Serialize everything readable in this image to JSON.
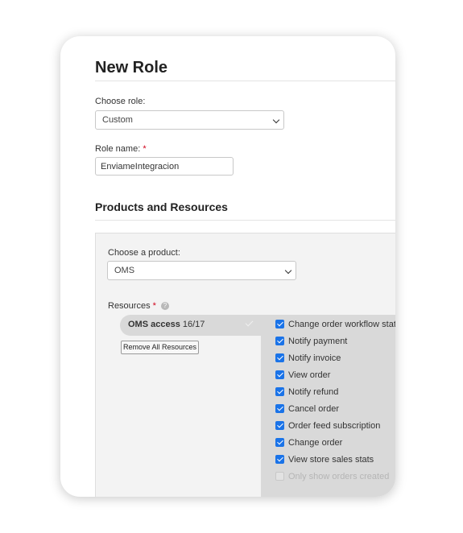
{
  "page": {
    "title": "New Role"
  },
  "role": {
    "choose_label": "Choose role:",
    "selected": "Custom",
    "name_label": "Role name:",
    "required_mark": "*",
    "name_value": "EnviameIntegracion"
  },
  "products": {
    "section_title": "Products and Resources",
    "choose_label": "Choose a product:",
    "selected": "OMS",
    "resources_label": "Resources",
    "help_glyph": "?",
    "product_name": "OMS access",
    "product_count": "16/17",
    "remove_all_label": "Remove All Resources",
    "resources": [
      {
        "label": "Change order workflow status",
        "checked": true
      },
      {
        "label": "Notify payment",
        "checked": true
      },
      {
        "label": "Notify invoice",
        "checked": true
      },
      {
        "label": "View order",
        "checked": true
      },
      {
        "label": "Notify refund",
        "checked": true
      },
      {
        "label": "Cancel order",
        "checked": true
      },
      {
        "label": "Order feed subscription",
        "checked": true
      },
      {
        "label": "Change order",
        "checked": true
      },
      {
        "label": "View store sales stats",
        "checked": true
      },
      {
        "label": "Only show orders created",
        "checked": false
      }
    ]
  },
  "colors": {
    "accent": "#1a73e8",
    "required": "#d0021b",
    "panel_bg": "#f3f3f3"
  }
}
